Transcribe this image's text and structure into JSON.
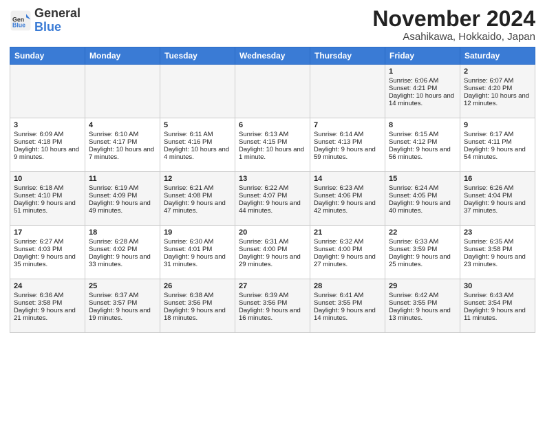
{
  "header": {
    "logo_general": "General",
    "logo_blue": "Blue",
    "month_title": "November 2024",
    "location": "Asahikawa, Hokkaido, Japan"
  },
  "days_of_week": [
    "Sunday",
    "Monday",
    "Tuesday",
    "Wednesday",
    "Thursday",
    "Friday",
    "Saturday"
  ],
  "weeks": [
    [
      {
        "day": "",
        "sunrise": "",
        "sunset": "",
        "daylight": ""
      },
      {
        "day": "",
        "sunrise": "",
        "sunset": "",
        "daylight": ""
      },
      {
        "day": "",
        "sunrise": "",
        "sunset": "",
        "daylight": ""
      },
      {
        "day": "",
        "sunrise": "",
        "sunset": "",
        "daylight": ""
      },
      {
        "day": "",
        "sunrise": "",
        "sunset": "",
        "daylight": ""
      },
      {
        "day": "1",
        "sunrise": "Sunrise: 6:06 AM",
        "sunset": "Sunset: 4:21 PM",
        "daylight": "Daylight: 10 hours and 14 minutes."
      },
      {
        "day": "2",
        "sunrise": "Sunrise: 6:07 AM",
        "sunset": "Sunset: 4:20 PM",
        "daylight": "Daylight: 10 hours and 12 minutes."
      }
    ],
    [
      {
        "day": "3",
        "sunrise": "Sunrise: 6:09 AM",
        "sunset": "Sunset: 4:18 PM",
        "daylight": "Daylight: 10 hours and 9 minutes."
      },
      {
        "day": "4",
        "sunrise": "Sunrise: 6:10 AM",
        "sunset": "Sunset: 4:17 PM",
        "daylight": "Daylight: 10 hours and 7 minutes."
      },
      {
        "day": "5",
        "sunrise": "Sunrise: 6:11 AM",
        "sunset": "Sunset: 4:16 PM",
        "daylight": "Daylight: 10 hours and 4 minutes."
      },
      {
        "day": "6",
        "sunrise": "Sunrise: 6:13 AM",
        "sunset": "Sunset: 4:15 PM",
        "daylight": "Daylight: 10 hours and 1 minute."
      },
      {
        "day": "7",
        "sunrise": "Sunrise: 6:14 AM",
        "sunset": "Sunset: 4:13 PM",
        "daylight": "Daylight: 9 hours and 59 minutes."
      },
      {
        "day": "8",
        "sunrise": "Sunrise: 6:15 AM",
        "sunset": "Sunset: 4:12 PM",
        "daylight": "Daylight: 9 hours and 56 minutes."
      },
      {
        "day": "9",
        "sunrise": "Sunrise: 6:17 AM",
        "sunset": "Sunset: 4:11 PM",
        "daylight": "Daylight: 9 hours and 54 minutes."
      }
    ],
    [
      {
        "day": "10",
        "sunrise": "Sunrise: 6:18 AM",
        "sunset": "Sunset: 4:10 PM",
        "daylight": "Daylight: 9 hours and 51 minutes."
      },
      {
        "day": "11",
        "sunrise": "Sunrise: 6:19 AM",
        "sunset": "Sunset: 4:09 PM",
        "daylight": "Daylight: 9 hours and 49 minutes."
      },
      {
        "day": "12",
        "sunrise": "Sunrise: 6:21 AM",
        "sunset": "Sunset: 4:08 PM",
        "daylight": "Daylight: 9 hours and 47 minutes."
      },
      {
        "day": "13",
        "sunrise": "Sunrise: 6:22 AM",
        "sunset": "Sunset: 4:07 PM",
        "daylight": "Daylight: 9 hours and 44 minutes."
      },
      {
        "day": "14",
        "sunrise": "Sunrise: 6:23 AM",
        "sunset": "Sunset: 4:06 PM",
        "daylight": "Daylight: 9 hours and 42 minutes."
      },
      {
        "day": "15",
        "sunrise": "Sunrise: 6:24 AM",
        "sunset": "Sunset: 4:05 PM",
        "daylight": "Daylight: 9 hours and 40 minutes."
      },
      {
        "day": "16",
        "sunrise": "Sunrise: 6:26 AM",
        "sunset": "Sunset: 4:04 PM",
        "daylight": "Daylight: 9 hours and 37 minutes."
      }
    ],
    [
      {
        "day": "17",
        "sunrise": "Sunrise: 6:27 AM",
        "sunset": "Sunset: 4:03 PM",
        "daylight": "Daylight: 9 hours and 35 minutes."
      },
      {
        "day": "18",
        "sunrise": "Sunrise: 6:28 AM",
        "sunset": "Sunset: 4:02 PM",
        "daylight": "Daylight: 9 hours and 33 minutes."
      },
      {
        "day": "19",
        "sunrise": "Sunrise: 6:30 AM",
        "sunset": "Sunset: 4:01 PM",
        "daylight": "Daylight: 9 hours and 31 minutes."
      },
      {
        "day": "20",
        "sunrise": "Sunrise: 6:31 AM",
        "sunset": "Sunset: 4:00 PM",
        "daylight": "Daylight: 9 hours and 29 minutes."
      },
      {
        "day": "21",
        "sunrise": "Sunrise: 6:32 AM",
        "sunset": "Sunset: 4:00 PM",
        "daylight": "Daylight: 9 hours and 27 minutes."
      },
      {
        "day": "22",
        "sunrise": "Sunrise: 6:33 AM",
        "sunset": "Sunset: 3:59 PM",
        "daylight": "Daylight: 9 hours and 25 minutes."
      },
      {
        "day": "23",
        "sunrise": "Sunrise: 6:35 AM",
        "sunset": "Sunset: 3:58 PM",
        "daylight": "Daylight: 9 hours and 23 minutes."
      }
    ],
    [
      {
        "day": "24",
        "sunrise": "Sunrise: 6:36 AM",
        "sunset": "Sunset: 3:58 PM",
        "daylight": "Daylight: 9 hours and 21 minutes."
      },
      {
        "day": "25",
        "sunrise": "Sunrise: 6:37 AM",
        "sunset": "Sunset: 3:57 PM",
        "daylight": "Daylight: 9 hours and 19 minutes."
      },
      {
        "day": "26",
        "sunrise": "Sunrise: 6:38 AM",
        "sunset": "Sunset: 3:56 PM",
        "daylight": "Daylight: 9 hours and 18 minutes."
      },
      {
        "day": "27",
        "sunrise": "Sunrise: 6:39 AM",
        "sunset": "Sunset: 3:56 PM",
        "daylight": "Daylight: 9 hours and 16 minutes."
      },
      {
        "day": "28",
        "sunrise": "Sunrise: 6:41 AM",
        "sunset": "Sunset: 3:55 PM",
        "daylight": "Daylight: 9 hours and 14 minutes."
      },
      {
        "day": "29",
        "sunrise": "Sunrise: 6:42 AM",
        "sunset": "Sunset: 3:55 PM",
        "daylight": "Daylight: 9 hours and 13 minutes."
      },
      {
        "day": "30",
        "sunrise": "Sunrise: 6:43 AM",
        "sunset": "Sunset: 3:54 PM",
        "daylight": "Daylight: 9 hours and 11 minutes."
      }
    ]
  ]
}
